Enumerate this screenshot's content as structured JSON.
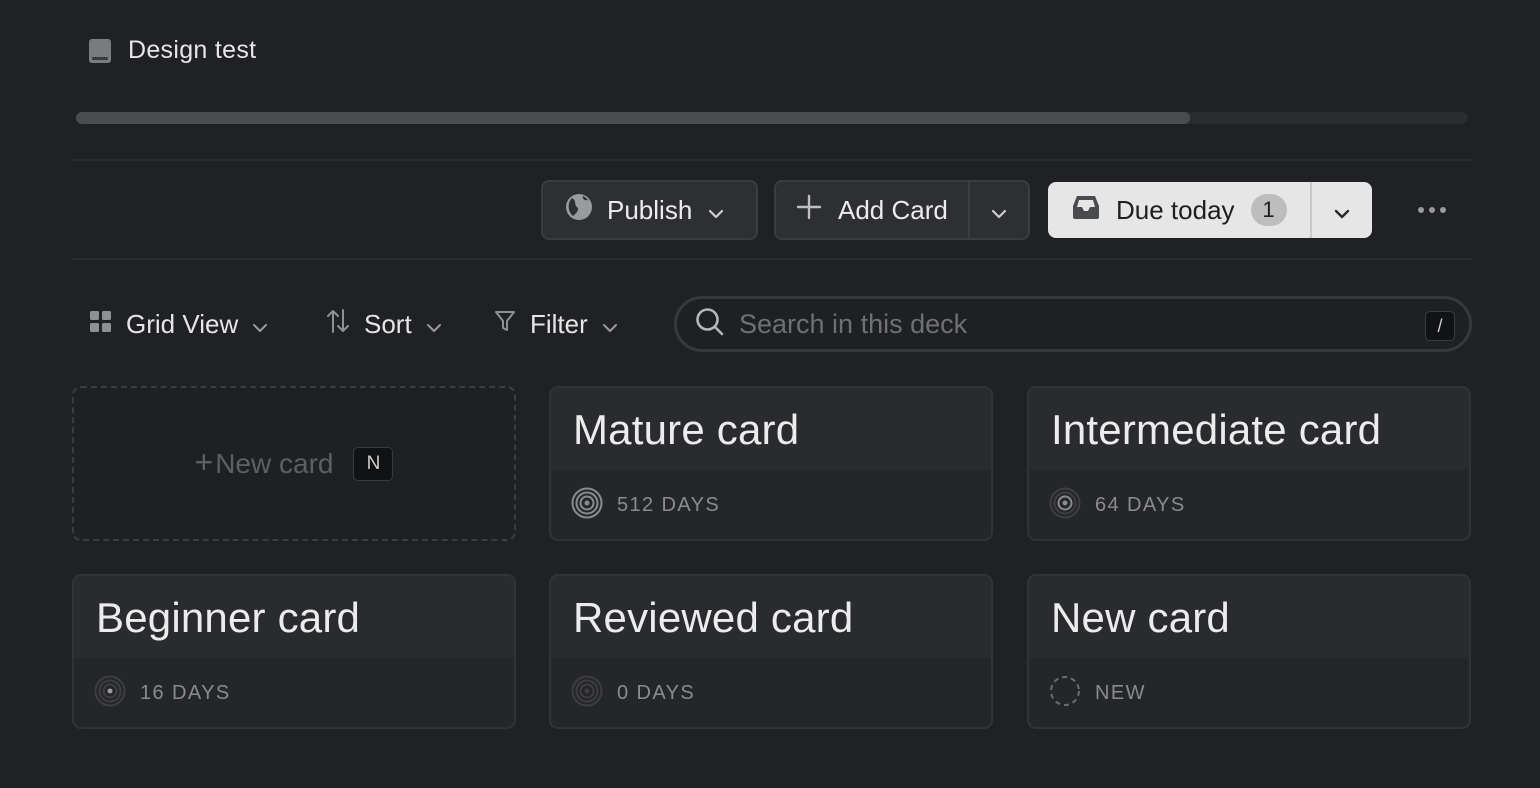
{
  "deck": {
    "title": "Design test",
    "progress": 0.8
  },
  "toolbar": {
    "publish_label": "Publish",
    "add_card_label": "Add Card",
    "due_label": "Due today",
    "due_count": "1"
  },
  "view": {
    "grid_label": "Grid View",
    "sort_label": "Sort",
    "filter_label": "Filter"
  },
  "search": {
    "placeholder": "Search in this deck",
    "shortcut": "/"
  },
  "new_card": {
    "plus": "+",
    "label": "New card",
    "shortcut": "N"
  },
  "cards": [
    {
      "title": "Mature card",
      "status": "512 DAYS",
      "level": "mature"
    },
    {
      "title": "Intermediate card",
      "status": "64 DAYS",
      "level": "intermediate"
    },
    {
      "title": "Beginner card",
      "status": "16 DAYS",
      "level": "beginner"
    },
    {
      "title": "Reviewed card",
      "status": "0 DAYS",
      "level": "reviewed"
    },
    {
      "title": "New card",
      "status": "NEW",
      "level": "new"
    }
  ],
  "icons": {
    "deck": "book-icon",
    "publish": "globe-icon",
    "add": "plus-icon",
    "due": "inbox-icon",
    "more": "more-icon",
    "grid": "grid-icon",
    "sort": "sort-icon",
    "filter": "filter-icon",
    "search": "search-icon"
  },
  "colors": {
    "background": "#202124",
    "card": "#25262a",
    "due_button": "#e6e6e6"
  }
}
